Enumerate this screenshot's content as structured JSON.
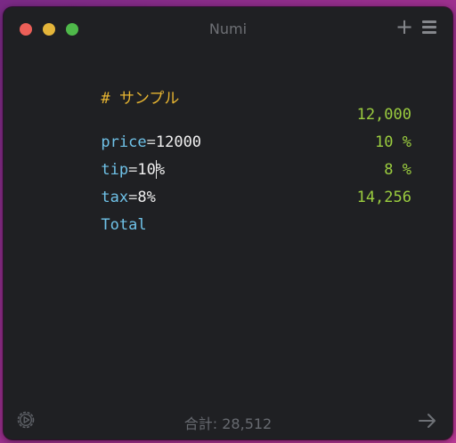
{
  "window": {
    "title": "Numi",
    "toolbar": {
      "add_icon": "plus-icon",
      "menu_icon": "hamburger-menu-icon"
    }
  },
  "editor": {
    "heading": "# サンプル",
    "lines": [
      {
        "var": "price",
        "op": "=",
        "value": "12000",
        "result": "12,000"
      },
      {
        "var": "tip",
        "op": "=",
        "value_before_caret": "10",
        "value_after_caret": "%",
        "result": "10 %"
      },
      {
        "var": "tax",
        "op": "=",
        "value": "8%",
        "result": "8 %"
      },
      {
        "var": "Total",
        "result": "14,256"
      }
    ]
  },
  "footer": {
    "total": "合計: 28,512",
    "settings_icon": "gear-icon",
    "share_icon": "arrow-right-icon"
  },
  "colors": {
    "window_bg": "#1f2023",
    "variable": "#6fc2e8",
    "result": "#9bcd3f",
    "heading": "#e6b431",
    "muted": "#676a70"
  }
}
